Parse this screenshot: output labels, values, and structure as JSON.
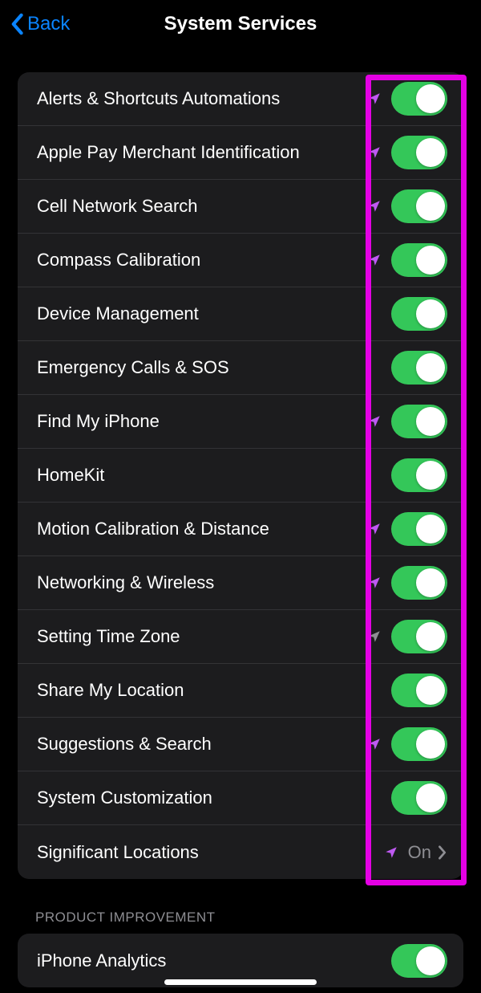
{
  "nav": {
    "back_label": "Back",
    "title": "System Services"
  },
  "section1": {
    "rows": [
      {
        "label": "Alerts & Shortcuts Automations",
        "loc": "purple",
        "toggle": true
      },
      {
        "label": "Apple Pay Merchant Identification",
        "loc": "purple",
        "toggle": true
      },
      {
        "label": "Cell Network Search",
        "loc": "purple",
        "toggle": true
      },
      {
        "label": "Compass Calibration",
        "loc": "purple",
        "toggle": true
      },
      {
        "label": "Device Management",
        "loc": null,
        "toggle": true
      },
      {
        "label": "Emergency Calls & SOS",
        "loc": null,
        "toggle": true
      },
      {
        "label": "Find My iPhone",
        "loc": "purple",
        "toggle": true
      },
      {
        "label": "HomeKit",
        "loc": null,
        "toggle": true
      },
      {
        "label": "Motion Calibration & Distance",
        "loc": "purple",
        "toggle": true
      },
      {
        "label": "Networking & Wireless",
        "loc": "purple",
        "toggle": true
      },
      {
        "label": "Setting Time Zone",
        "loc": "gray",
        "toggle": true
      },
      {
        "label": "Share My Location",
        "loc": null,
        "toggle": true
      },
      {
        "label": "Suggestions & Search",
        "loc": "purple",
        "toggle": true
      },
      {
        "label": "System Customization",
        "loc": null,
        "toggle": true
      },
      {
        "label": "Significant Locations",
        "loc": "purple",
        "value": "On",
        "nav": true
      }
    ]
  },
  "section2": {
    "header": "PRODUCT IMPROVEMENT",
    "rows": [
      {
        "label": "iPhone Analytics",
        "loc": null,
        "toggle": true
      }
    ]
  },
  "colors": {
    "accent_blue": "#0A84FF",
    "toggle_green": "#34C759",
    "loc_purple": "#BF5AF2",
    "loc_gray": "#8E8E93",
    "highlight": "#E400E4"
  }
}
